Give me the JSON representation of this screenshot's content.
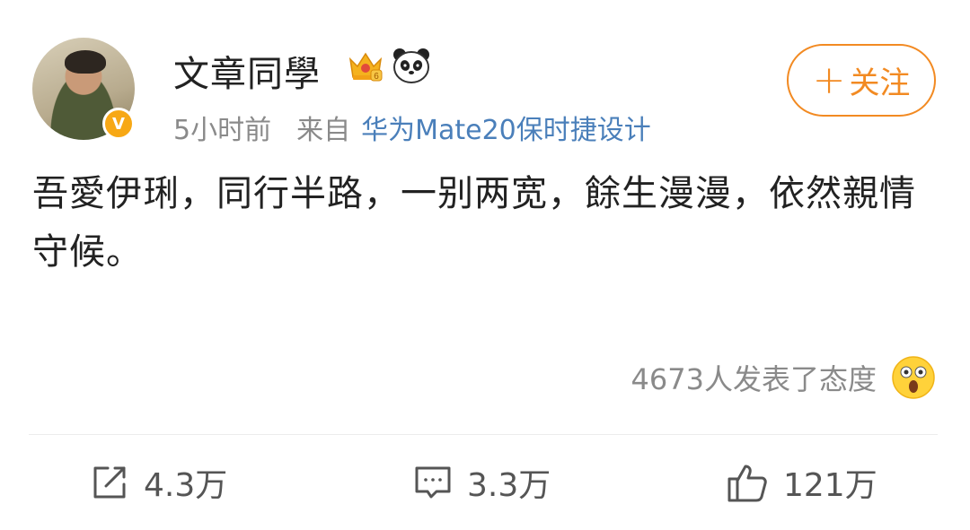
{
  "post": {
    "username": "文章同學",
    "time_ago": "5小时前",
    "source_prefix": "来自",
    "device": "华为Mate20保时捷设计",
    "follow_label": "关注",
    "content": "吾愛伊琍，同行半路，一别两宽，餘生漫漫，依然親情守候。"
  },
  "reactions": {
    "count_text": "4673人发表了态度"
  },
  "actions": {
    "repost_count": "4.3万",
    "comment_count": "3.3万",
    "like_count": "121万"
  },
  "icons": {
    "badge": "crown-vip-icon",
    "panda": "panda-icon",
    "verified": "verified-v-badge-icon",
    "reaction": "shocked-face-icon",
    "repost": "repost-icon",
    "comment": "comment-icon",
    "like": "thumbs-up-icon"
  },
  "colors": {
    "accent_orange": "#f28a22",
    "link_blue": "#4a7fba",
    "verified_badge": "#f7a815",
    "muted_text": "#8a8a8a"
  }
}
